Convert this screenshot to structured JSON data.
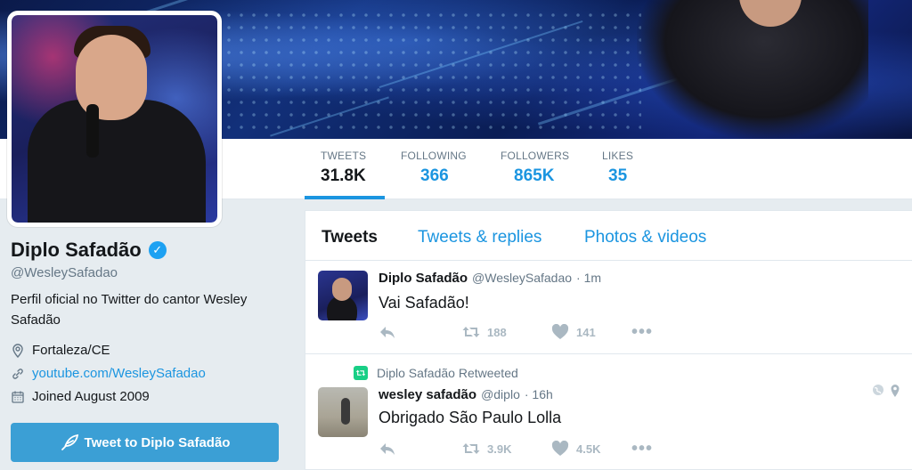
{
  "stats": {
    "tweets": {
      "label": "TWEETS",
      "value": "31.8K"
    },
    "following": {
      "label": "FOLLOWING",
      "value": "366"
    },
    "followers": {
      "label": "FOLLOWERS",
      "value": "865K"
    },
    "likes": {
      "label": "LIKES",
      "value": "35"
    }
  },
  "profile": {
    "name": "Diplo Safadão",
    "handle": "@WesleySafadao",
    "bio": "Perfil oficial no Twitter do cantor Wesley Safadão",
    "location": "Fortaleza/CE",
    "url": "youtube.com/WesleySafadao",
    "joined": "Joined August 2009",
    "tweet_to_label": "Tweet to Diplo Safadão"
  },
  "timeline": {
    "tabs": [
      {
        "label": "Tweets",
        "active": true
      },
      {
        "label": "Tweets & replies",
        "active": false
      },
      {
        "label": "Photos & videos",
        "active": false
      }
    ],
    "tweets": [
      {
        "name": "Diplo Safadão",
        "handle": "@WesleySafadao",
        "time": "· 1m",
        "text": "Vai Safadão!",
        "retweets": "188",
        "likes": "141"
      },
      {
        "retweet_note": "Diplo Safadão Retweeted",
        "name": "wesley safadão",
        "handle": "@diplo",
        "time": "· 16h",
        "text": "Obrigado São Paulo Lolla",
        "retweets": "3.9K",
        "likes": "4.5K"
      }
    ]
  },
  "colors": {
    "accent": "#1b95e0",
    "button": "#3b9fd5",
    "retweet_green": "#19cf86",
    "verified": "#1da1f2"
  }
}
